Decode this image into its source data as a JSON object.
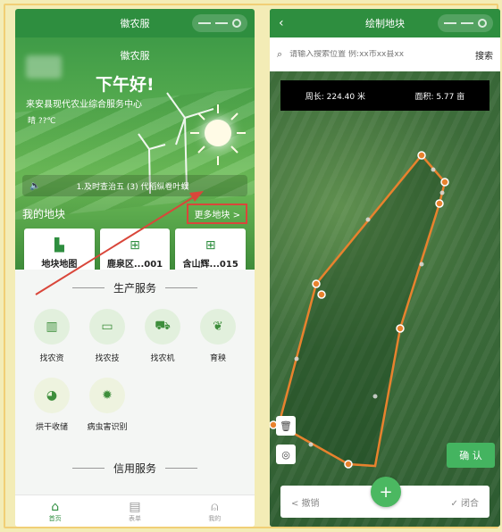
{
  "left": {
    "title": "徽农服",
    "hero_title": "徽农服",
    "greeting": "下午好!",
    "center_name": "来安县现代农业综合服务中心",
    "weather": "晴  ??℃",
    "notice_text": "1.及时查治五 (3) 代稻纵卷叶螟",
    "my_lands": "我的地块",
    "more_lands": "更多地块 >",
    "land_cards": [
      {
        "label": "地块地图"
      },
      {
        "label": "鹿泉区...001"
      },
      {
        "label": "含山辉...015"
      }
    ],
    "section_production": "生产服务",
    "production_services": [
      {
        "label": "找农资"
      },
      {
        "label": "找农技"
      },
      {
        "label": "找农机"
      },
      {
        "label": "育秧"
      },
      {
        "label": "烘干收储"
      },
      {
        "label": "病虫害识别"
      }
    ],
    "section_credit": "信用服务",
    "tabs": [
      {
        "label": "首页"
      },
      {
        "label": "表单"
      },
      {
        "label": "我的"
      }
    ]
  },
  "right": {
    "title": "绘制地块",
    "search_placeholder": "请输入搜索位置 例:xx市xx县xx",
    "search_button": "搜索",
    "perimeter": "周长: 224.40 米",
    "area": "面积: 5.77 亩",
    "confirm": "确 认",
    "undo": "< 撤销",
    "close": "✓ 闭合"
  },
  "colors": {
    "primary_green": "#2e8e3f",
    "polygon_stroke": "#e8822e",
    "annotation_red": "#d9463a"
  }
}
